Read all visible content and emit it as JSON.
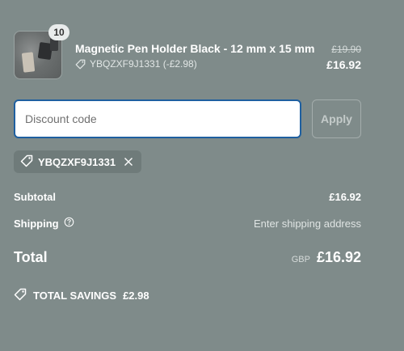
{
  "product": {
    "quantity": "10",
    "name": "Magnetic Pen Holder Black - 12 mm x 15 mm",
    "discount_line": "YBQZXF9J1331 (-£2.98)",
    "original_price": "£19.90",
    "price": "£16.92"
  },
  "discount": {
    "placeholder": "Discount code",
    "apply_label": "Apply",
    "applied_code": "YBQZXF9J1331"
  },
  "summary": {
    "subtotal_label": "Subtotal",
    "subtotal_value": "£16.92",
    "shipping_label": "Shipping",
    "shipping_value": "Enter shipping address",
    "total_label": "Total",
    "currency": "GBP",
    "total_value": "£16.92",
    "savings_label": "TOTAL SAVINGS",
    "savings_value": "£2.98"
  },
  "icons": {
    "tag": "tag-icon",
    "close": "close-icon",
    "help": "help-icon",
    "savings": "savings-tag-icon"
  },
  "colors": {
    "background": "#7f8b8a",
    "input_border": "#1e5fa0"
  }
}
